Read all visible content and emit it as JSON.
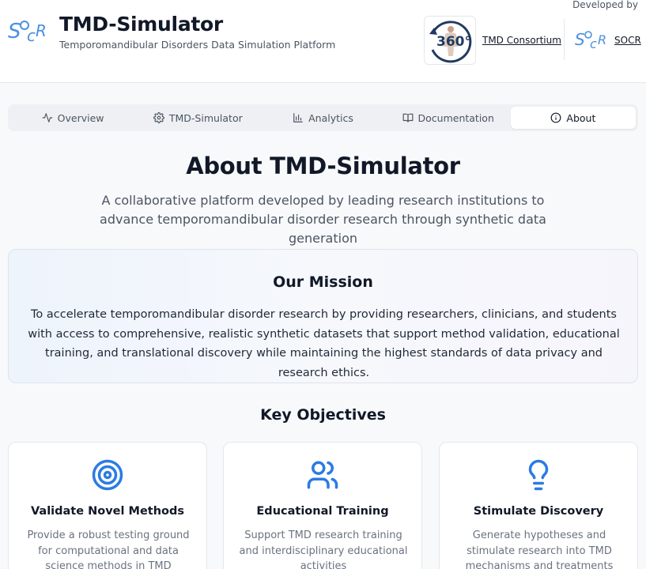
{
  "header": {
    "title": "TMD-Simulator",
    "subtitle": "Temporomandibular Disorders Data Simulation Platform",
    "developed_by": "Developed by",
    "badge_text": "360°",
    "consortium_link": "TMD Consortium",
    "socr_link": "SOCR"
  },
  "tabs": [
    {
      "label": "Overview",
      "icon": "activity-icon",
      "active": false
    },
    {
      "label": "TMD-Simulator",
      "icon": "gear-icon",
      "active": false
    },
    {
      "label": "Analytics",
      "icon": "bar-chart-icon",
      "active": false
    },
    {
      "label": "Documentation",
      "icon": "book-icon",
      "active": false
    },
    {
      "label": "About",
      "icon": "info-icon",
      "active": true
    }
  ],
  "hero": {
    "title": "About TMD-Simulator",
    "lead": "A collaborative platform developed by leading research institutions to advance temporomandibular disorder research through synthetic data generation"
  },
  "mission": {
    "title": "Our Mission",
    "text": "To accelerate temporomandibular disorder research by providing researchers, clinicians, and students with access to comprehensive, realistic synthetic datasets that support method validation, educational training, and translational discovery while maintaining the highest standards of data privacy and research ethics."
  },
  "objectives": {
    "title": "Key Objectives",
    "items": [
      {
        "title": "Validate Novel Methods",
        "description": "Provide a robust testing ground for computational and data science methods in TMD research",
        "icon": "target-icon"
      },
      {
        "title": "Educational Training",
        "description": "Support TMD research training and interdisciplinary educational activities",
        "icon": "users-icon"
      },
      {
        "title": "Stimulate Discovery",
        "description": "Generate hypotheses and stimulate research into TMD mechanisms and treatments",
        "icon": "lightbulb-icon"
      }
    ]
  },
  "colors": {
    "accent": "#2b7be4",
    "brand_dark": "#1f3a5f",
    "text_primary": "#111827",
    "text_muted": "#6b7280"
  }
}
